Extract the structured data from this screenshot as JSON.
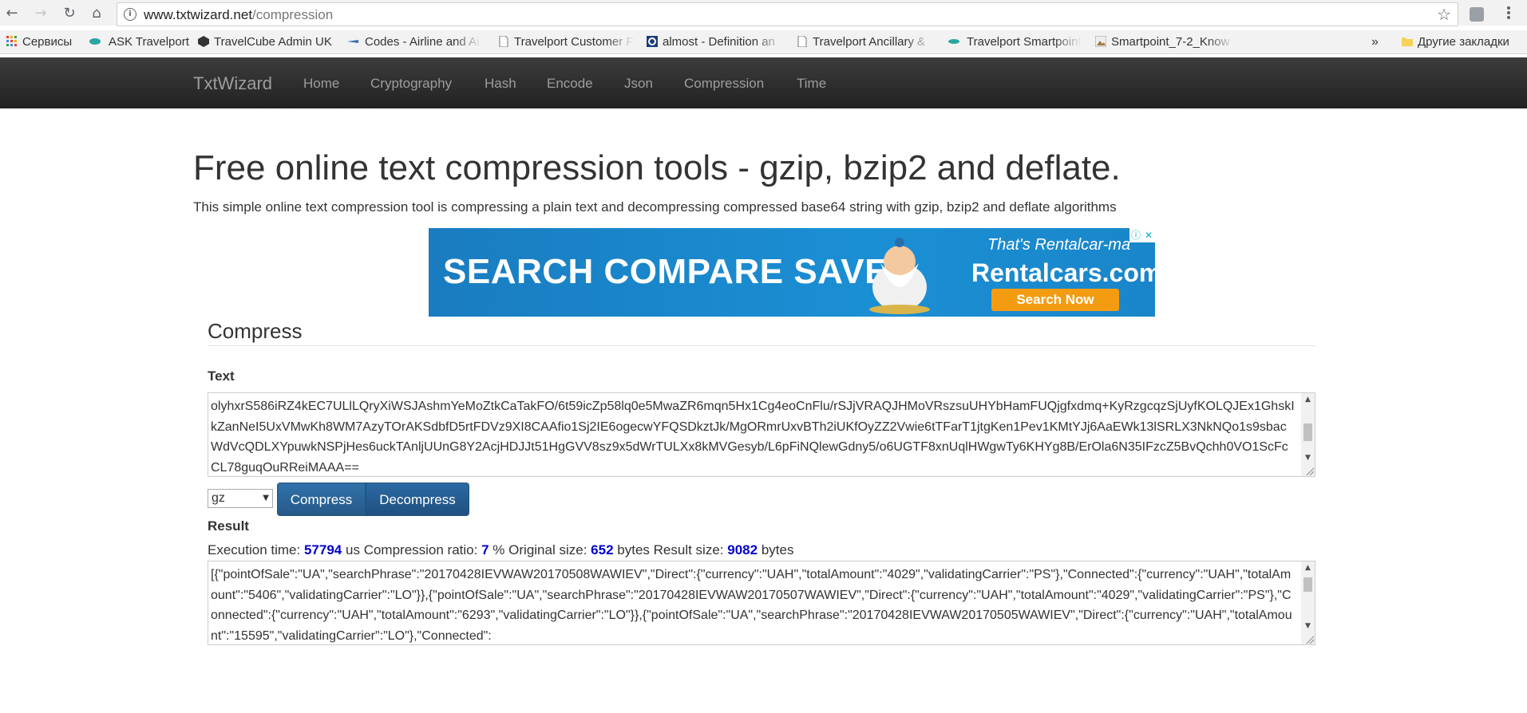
{
  "browser": {
    "url_domain": "www.txtwizard.net",
    "url_path": "/compression",
    "bookmarks": [
      {
        "label": "Сервисы"
      },
      {
        "label": "ASK Travelport"
      },
      {
        "label": "TravelCube Admin UK"
      },
      {
        "label": "Codes - Airline and Ai"
      },
      {
        "label": "Travelport Customer P"
      },
      {
        "label": "almost - Definition an"
      },
      {
        "label": "Travelport Ancillary &"
      },
      {
        "label": "Travelport Smartpoint"
      },
      {
        "label": "Smartpoint_7-2_Know"
      }
    ],
    "more": "»",
    "other_bookmarks": "Другие закладки"
  },
  "nav": {
    "brand": "TxtWizard",
    "links": [
      "Home",
      "Cryptography",
      "Hash",
      "Encode",
      "Json",
      "Compression",
      "Time"
    ]
  },
  "page": {
    "title": "Free online text compression tools - gzip, bzip2 and deflate.",
    "lead": "This simple online text compression tool is compressing a plain text and decompressing compressed base64 string with gzip, bzip2 and deflate algorithms"
  },
  "ad": {
    "headline": "SEARCH COMPARE SAVE",
    "tagline": "That's Rentalcar-ma",
    "brand": "Rentalcars.com",
    "button": "Search Now"
  },
  "compress": {
    "section_title": "Compress",
    "text_label": "Text",
    "text_value": "olyhxrS586iRZ4kEC7ULlLQryXiWSJAshmYeMoZtkCaTakFO/6t59icZp58lq0e5MwaZR6mqn5Hx1Cg4eoCnFlu/rSJjVRAQJHMoVRszsuUHYbHamFUQjgfxdmq+KyRzgcqzSjUyfKOLQJEx1GhskIkZanNeI5UxVMwKh8WM7AzyTOrAKSdbfD5rtFDVz9XI8CAAfio1Sj2IE6ogecwYFQSDkztJk/MgORmrUxvBTh2iUKfOyZZ2Vwie6tTFarT1jtgKen1Pev1KMtYJj6AaEWk13lSRLX3NkNQo1s9sbacWdVcQDLXYpuwkNSPjHes6uckTAnljUUnG8Y2AcjHDJJt51HgGVV8sz9x5dWrTULXx8kMVGesyb/L6pFiNQlewGdny5/o6UGTF8xnUqlHWgwTy6KHYg8B/ErOla6N35IFzcZ5BvQchh0VO1ScFcCL78guqOuRReiMAAA==",
    "format_selected": "gz",
    "compress_button": "Compress",
    "decompress_button": "Decompress"
  },
  "result": {
    "label": "Result",
    "exec_label": "Execution time:",
    "exec_time": "57794",
    "exec_unit": "us",
    "ratio_label": "Compression ratio:",
    "ratio": "7",
    "ratio_unit": "%",
    "orig_label": "Original size:",
    "orig_size": "652",
    "orig_unit": "bytes",
    "result_label": "Result size:",
    "result_size": "9082",
    "result_unit": "bytes",
    "value": "[{\"pointOfSale\":\"UA\",\"searchPhrase\":\"20170428IEVWAW20170508WAWIEV\",\"Direct\":{\"currency\":\"UAH\",\"totalAmount\":\"4029\",\"validatingCarrier\":\"PS\"},\"Connected\":{\"currency\":\"UAH\",\"totalAmount\":\"5406\",\"validatingCarrier\":\"LO\"}},{\"pointOfSale\":\"UA\",\"searchPhrase\":\"20170428IEVWAW20170507WAWIEV\",\"Direct\":{\"currency\":\"UAH\",\"totalAmount\":\"4029\",\"validatingCarrier\":\"PS\"},\"Connected\":{\"currency\":\"UAH\",\"totalAmount\":\"6293\",\"validatingCarrier\":\"LO\"}},{\"pointOfSale\":\"UA\",\"searchPhrase\":\"20170428IEVWAW20170505WAWIEV\",\"Direct\":{\"currency\":\"UAH\",\"totalAmount\":\"15595\",\"validatingCarrier\":\"LO\"},\"Connected\":"
  }
}
